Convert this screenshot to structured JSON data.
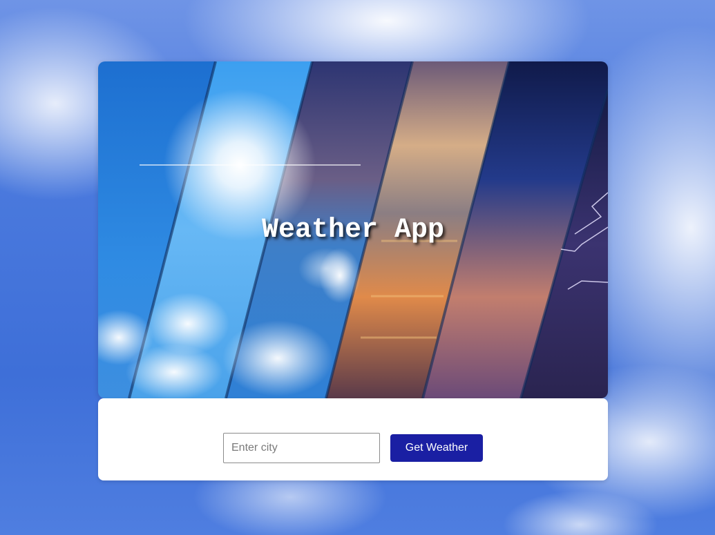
{
  "app": {
    "title": "Weather App"
  },
  "search": {
    "placeholder": "Enter city",
    "value": "",
    "button_label": "Get Weather"
  },
  "colors": {
    "button_bg": "#1a1fa3",
    "button_text": "#ffffff",
    "card_bg": "#ffffff",
    "sky_blue": "#3e6fd8"
  },
  "hero": {
    "image_description_icon": "weather-collage-image"
  }
}
